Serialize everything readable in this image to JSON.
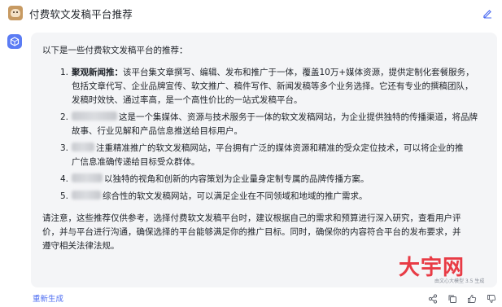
{
  "header": {
    "title": "付费软文发稿平台推荐"
  },
  "response": {
    "intro": "以下是一些付费软文发稿平台的推荐：",
    "items": [
      {
        "num": "1.",
        "name": "聚观新闻推：",
        "lines": [
          "该平台集文章撰写、编辑、发布和推广于一体，覆盖10万+媒体资源，提供定制化套餐服务，",
          "包括文章代写、企业品牌宣传、软文推广、稿件写作、新闻发稿等多个业务选择。它还有专业的撰稿团队，",
          "发稿时效快、通过率高，是一个高性价比的一站式发稿平台。"
        ]
      },
      {
        "num": "2.",
        "lines": [
          "这是一个集媒体、资源与技术服务于一体的软文发稿网站，为企业提供独特的传播渠道，将品牌",
          "故事、行业见解和产品信息推送给目标用户。"
        ]
      },
      {
        "num": "3.",
        "lines": [
          "注重精准推广的软文发稿网站，平台拥有广泛的媒体资源和精准的受众定位技术，可以将企业的推",
          "广信息准确传递给目标受众群体。"
        ]
      },
      {
        "num": "4.",
        "lines": [
          "以独特的视角和创新的内容策划为企业量身定制专属的品牌传播方案。"
        ]
      },
      {
        "num": "5.",
        "lines": [
          "综合性的软文发稿网站，可以满足企业在不同领域和地域的推广需求。"
        ]
      }
    ],
    "note_lines": [
      "请注意，这些推荐仅供参考，选择付费软文发稿平台时，建议根据自己的需求和预算进行深入研究，查看用户评",
      "价，并与平台进行沟通，确保选择的平台能够满足你的推广目标。同时，确保你的内容符合平台的发布要求，并",
      "遵守相关法律法规。"
    ]
  },
  "footer": {
    "regenerate_label": "重新生成"
  },
  "watermark": {
    "brand": "大宇网",
    "sub": "由文心大模型 3.5 生成"
  },
  "icons": {
    "edit": "edit-icon",
    "share": "share-icon",
    "copy": "copy-icon",
    "thumb_up": "thumb-up-icon",
    "thumb_down": "thumb-down-icon"
  },
  "colors": {
    "accent": "#4e6ef2",
    "bubble_bg": "#f4f5f7",
    "watermark": "#e8323c"
  }
}
